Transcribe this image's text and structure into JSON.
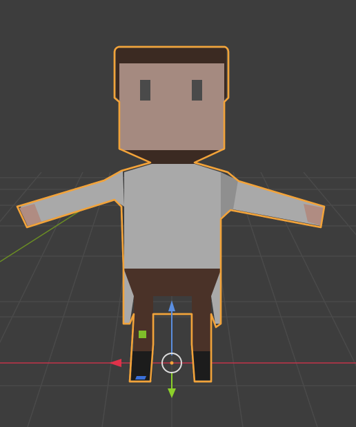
{
  "viewport": {
    "name": "3D Viewport",
    "background_color": "#3d3d3d",
    "grid_color": "#4a4a4a",
    "x_axis_color": "#c4334a",
    "y_axis_color": "#6b8e23"
  },
  "selection": {
    "outline_color": "#f2a33a",
    "object": "character"
  },
  "character": {
    "hair_color": "#3b2a22",
    "skin_color": "#a58a80",
    "eye_color": "#4a4a4a",
    "shirt_color": "#a9a9a9",
    "pants_color": "#4a3228",
    "shoe_color": "#1c1c1c",
    "hand_color": "#b08c82"
  },
  "gizmo": {
    "type": "transform-gizmo",
    "z_arrow_color": "#5a8ee0",
    "y_arrow_color": "#8cd02a",
    "x_arrow_color": "#e0324a",
    "center_ring_color": "#dddddd",
    "origin_color": "#f2a33a"
  },
  "markers": {
    "green_marker_color": "#7fbf2a",
    "blue_marker_color": "#3a6fd8"
  }
}
